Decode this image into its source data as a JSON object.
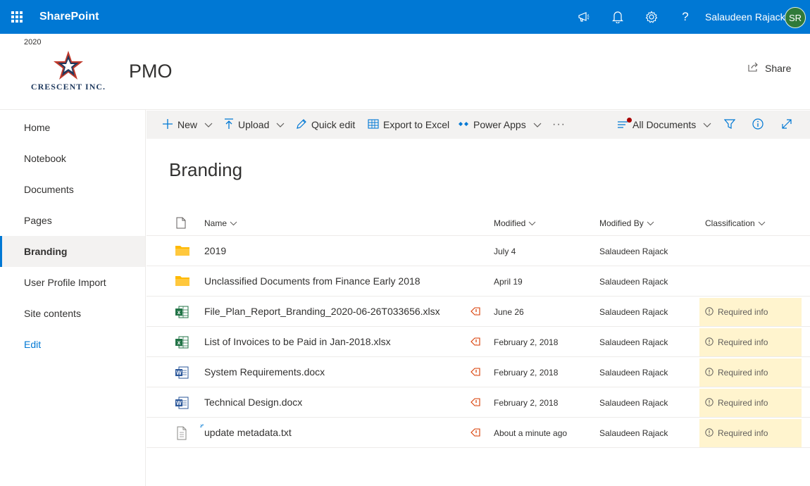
{
  "suite": {
    "app_name": "SharePoint",
    "user_name": "Salaudeen Rajack",
    "user_initials": "SR",
    "help_glyph": "?"
  },
  "site": {
    "year": "2020",
    "logo_text": "Crescent Inc.",
    "title": "PMO",
    "share_label": "Share"
  },
  "nav": {
    "items": [
      {
        "label": "Home"
      },
      {
        "label": "Notebook"
      },
      {
        "label": "Documents"
      },
      {
        "label": "Pages"
      },
      {
        "label": "Branding"
      },
      {
        "label": "User Profile Import"
      },
      {
        "label": "Site contents"
      }
    ],
    "edit_label": "Edit"
  },
  "commands": {
    "new_label": "New",
    "upload_label": "Upload",
    "quick_edit_label": "Quick edit",
    "export_label": "Export to Excel",
    "power_apps_label": "Power Apps",
    "more_label": "···",
    "view_label": "All Documents"
  },
  "library": {
    "title": "Branding",
    "columns": {
      "name": "Name",
      "modified": "Modified",
      "modified_by": "Modified By",
      "classification": "Classification"
    },
    "rows": [
      {
        "type": "folder",
        "name": "2019",
        "modified": "July 4",
        "modified_by": "Salaudeen Rajack",
        "classification": ""
      },
      {
        "type": "folder",
        "name": "Unclassified Documents from Finance Early 2018",
        "modified": "April 19",
        "modified_by": "Salaudeen Rajack",
        "classification": ""
      },
      {
        "type": "excel",
        "name": "File_Plan_Report_Branding_2020-06-26T033656.xlsx",
        "modified": "June 26",
        "modified_by": "Salaudeen Rajack",
        "classification": "Required info"
      },
      {
        "type": "excel",
        "name": "List of Invoices to be Paid in Jan-2018.xlsx",
        "modified": "February 2, 2018",
        "modified_by": "Salaudeen Rajack",
        "classification": "Required info"
      },
      {
        "type": "word",
        "name": "System Requirements.docx",
        "modified": "February 2, 2018",
        "modified_by": "Salaudeen Rajack",
        "classification": "Required info"
      },
      {
        "type": "word",
        "name": "Technical Design.docx",
        "modified": "February 2, 2018",
        "modified_by": "Salaudeen Rajack",
        "classification": "Required info"
      },
      {
        "type": "text",
        "name": "update metadata.txt",
        "modified": "About a minute ago",
        "modified_by": "Salaudeen Rajack",
        "classification": "Required info"
      }
    ]
  },
  "colors": {
    "suite_bar": "#0078d4",
    "accent": "#0078d4",
    "required_info_bg": "#fff4ce",
    "excel_green": "#217346",
    "word_blue": "#2b579a",
    "folder_yellow": "#ffb900"
  }
}
